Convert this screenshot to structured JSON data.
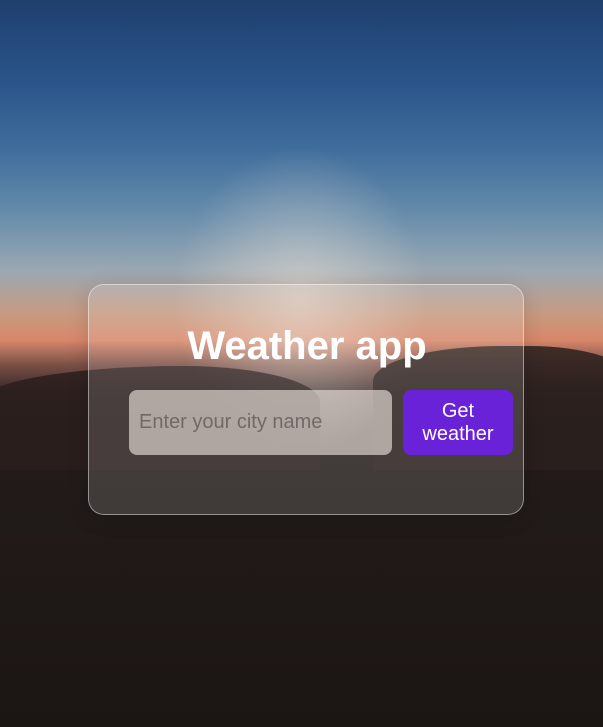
{
  "app": {
    "title": "Weather app"
  },
  "form": {
    "city_input": {
      "value": "",
      "placeholder": "Enter your city name"
    },
    "submit_label": "Get weather"
  },
  "colors": {
    "button_background": "#6a22d8",
    "title_text": "#ffffff",
    "button_text": "#ffffff"
  }
}
